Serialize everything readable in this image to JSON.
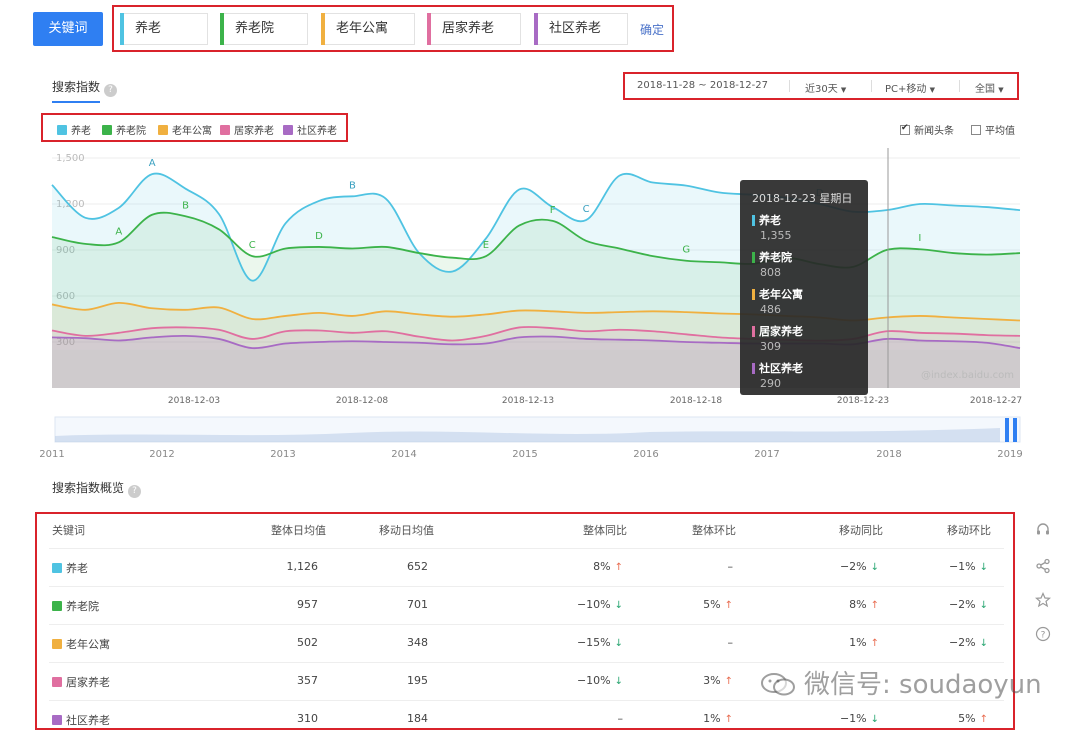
{
  "keywords": {
    "label": "关键词",
    "items": [
      {
        "name": "养老",
        "color": "#4fc3e2"
      },
      {
        "name": "养老院",
        "color": "#3cb34a"
      },
      {
        "name": "老年公寓",
        "color": "#f0b040"
      },
      {
        "name": "居家养老",
        "color": "#e06fa0"
      },
      {
        "name": "社区养老",
        "color": "#a86bc4"
      }
    ],
    "confirm": "确定"
  },
  "panel": {
    "tab": "搜索指数",
    "help": "?",
    "filters": {
      "date_range": "2018-11-28 ~ 2018-12-27",
      "period": "近30天",
      "device": "PC+移动",
      "region": "全国"
    },
    "options": {
      "news": "新闻头条",
      "average": "平均值"
    },
    "watermark": "@index.baidu.com"
  },
  "chart_data": {
    "type": "line",
    "ylim": [
      0,
      1500
    ],
    "yticks": [
      300,
      600,
      900,
      1200,
      1500
    ],
    "ytick_labels": [
      "300",
      "600",
      "900",
      "1,200",
      "1,500"
    ],
    "xtick_labels": [
      "2018-12-03",
      "2018-12-08",
      "2018-12-13",
      "2018-12-18",
      "2018-12-23",
      "2018-12-27"
    ],
    "series": [
      {
        "name": "养老",
        "color": "#4fc3e2",
        "values": [
          1325,
          1110,
          1175,
          1395,
          1300,
          1135,
          700,
          1075,
          1220,
          1250,
          1235,
          880,
          760,
          975,
          1295,
          1180,
          1095,
          1385,
          1340,
          1320,
          1275,
          1260,
          1240,
          1200,
          1150,
          1160,
          1200,
          1190,
          1180,
          1160
        ],
        "label_points": [
          {
            "i": 3,
            "t": "A"
          },
          {
            "i": 9,
            "t": "B"
          },
          {
            "i": 16,
            "t": "C"
          },
          {
            "i": 23,
            "t": "D"
          }
        ]
      },
      {
        "name": "养老院",
        "color": "#3cb34a",
        "values": [
          985,
          940,
          950,
          1130,
          1120,
          1035,
          860,
          910,
          920,
          910,
          920,
          880,
          850,
          860,
          1060,
          1090,
          960,
          910,
          860,
          830,
          820,
          810,
          850,
          808,
          790,
          900,
          905,
          880,
          870,
          880
        ],
        "label_points": [
          {
            "i": 2,
            "t": "A"
          },
          {
            "i": 4,
            "t": "B"
          },
          {
            "i": 6,
            "t": "C"
          },
          {
            "i": 8,
            "t": "D"
          },
          {
            "i": 13,
            "t": "E"
          },
          {
            "i": 15,
            "t": "F"
          },
          {
            "i": 19,
            "t": "G"
          },
          {
            "i": 26,
            "t": "I"
          }
        ]
      },
      {
        "name": "老年公寓",
        "color": "#f0b040",
        "values": [
          545,
          510,
          555,
          520,
          510,
          525,
          450,
          470,
          490,
          470,
          500,
          480,
          465,
          480,
          505,
          500,
          490,
          495,
          500,
          495,
          486,
          480,
          470,
          460,
          440,
          460,
          470,
          460,
          450,
          440
        ]
      },
      {
        "name": "居家养老",
        "color": "#e06fa0",
        "values": [
          375,
          340,
          360,
          390,
          395,
          380,
          320,
          370,
          375,
          360,
          370,
          335,
          310,
          340,
          395,
          390,
          370,
          380,
          370,
          350,
          330,
          320,
          315,
          309,
          320,
          370,
          360,
          355,
          345,
          340
        ]
      },
      {
        "name": "社区养老",
        "color": "#a86bc4",
        "values": [
          330,
          325,
          310,
          330,
          340,
          320,
          260,
          290,
          300,
          305,
          300,
          295,
          285,
          290,
          330,
          335,
          320,
          315,
          310,
          300,
          295,
          290,
          290,
          290,
          285,
          320,
          310,
          305,
          295,
          260
        ]
      }
    ],
    "highlight_index": 25,
    "overview_axis": [
      "2011",
      "2012",
      "2013",
      "2014",
      "2015",
      "2016",
      "2017",
      "2018",
      "2019"
    ]
  },
  "tooltip": {
    "date": "2018-12-23 星期日",
    "entries": [
      {
        "name": "养老",
        "value": "1,355",
        "color": "#4fc3e2"
      },
      {
        "name": "养老院",
        "value": "808",
        "color": "#3cb34a"
      },
      {
        "name": "老年公寓",
        "value": "486",
        "color": "#f0b040"
      },
      {
        "name": "居家养老",
        "value": "309",
        "color": "#e06fa0"
      },
      {
        "name": "社区养老",
        "value": "290",
        "color": "#a86bc4"
      }
    ]
  },
  "overview": {
    "title": "搜索指数概览",
    "headers": [
      "关键词",
      "整体日均值",
      "移动日均值",
      "整体同比",
      "整体环比",
      "移动同比",
      "移动环比"
    ],
    "rows": [
      {
        "name": "养老",
        "color": "#4fc3e2",
        "avg": "1,126",
        "mobile": "652",
        "yoy": "8%",
        "yoy_dir": "up",
        "mom": "–",
        "mom_dir": "",
        "myoy": "−2%",
        "myoy_dir": "down",
        "mmom": "−1%",
        "mmom_dir": "down"
      },
      {
        "name": "养老院",
        "color": "#3cb34a",
        "avg": "957",
        "mobile": "701",
        "yoy": "−10%",
        "yoy_dir": "down",
        "mom": "5%",
        "mom_dir": "up",
        "myoy": "8%",
        "myoy_dir": "up",
        "mmom": "−2%",
        "mmom_dir": "down"
      },
      {
        "name": "老年公寓",
        "color": "#f0b040",
        "avg": "502",
        "mobile": "348",
        "yoy": "−15%",
        "yoy_dir": "down",
        "mom": "–",
        "mom_dir": "",
        "myoy": "1%",
        "myoy_dir": "up",
        "mmom": "−2%",
        "mmom_dir": "down"
      },
      {
        "name": "居家养老",
        "color": "#e06fa0",
        "avg": "357",
        "mobile": "195",
        "yoy": "−10%",
        "yoy_dir": "down",
        "mom": "3%",
        "mom_dir": "up",
        "myoy": "",
        "myoy_dir": "",
        "mmom": "",
        "mmom_dir": ""
      },
      {
        "name": "社区养老",
        "color": "#a86bc4",
        "avg": "310",
        "mobile": "184",
        "yoy": "–",
        "yoy_dir": "",
        "mom": "1%",
        "mom_dir": "up",
        "myoy": "−1%",
        "myoy_dir": "down",
        "mmom": "5%",
        "mmom_dir": "up"
      }
    ]
  },
  "sidebar_icons": [
    "headset-icon",
    "share-icon",
    "star-icon",
    "help-icon"
  ],
  "watermark_text": "微信号: soudaoyun"
}
